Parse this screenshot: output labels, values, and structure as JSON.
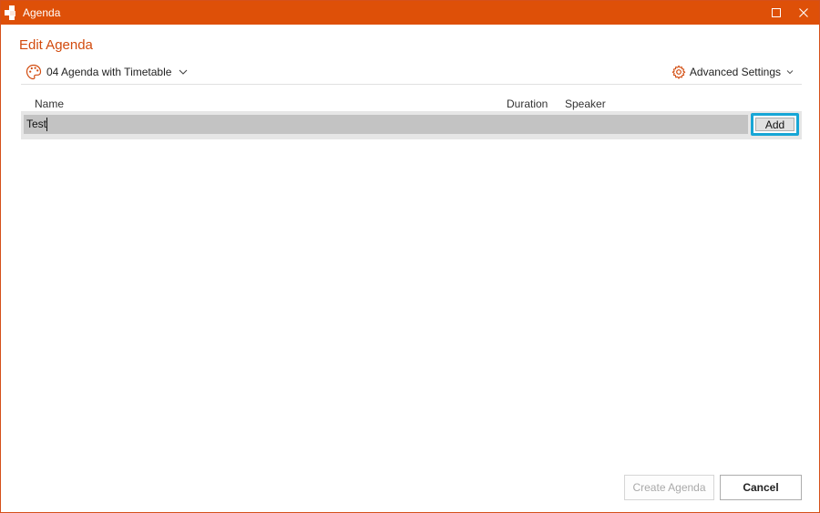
{
  "window": {
    "title": "Agenda",
    "titlebar_color": "#de5008",
    "icons": [
      "app-icon",
      "maximize-icon",
      "close-icon"
    ]
  },
  "dialog": {
    "heading": "Edit Agenda",
    "heading_color": "#d24b0e"
  },
  "toolbar": {
    "template_icon": "palette-icon",
    "template_label": "04 Agenda with Timetable",
    "advanced_icon": "gear-icon",
    "advanced_label": "Advanced Settings"
  },
  "table": {
    "columns": [
      "Name",
      "Duration",
      "Speaker"
    ],
    "new_item_value": "Test"
  },
  "add_button": {
    "label": "Add",
    "focus_color": "#17a6d6"
  },
  "footer": {
    "create_label": "Create Agenda",
    "create_enabled": false,
    "cancel_label": "Cancel"
  }
}
